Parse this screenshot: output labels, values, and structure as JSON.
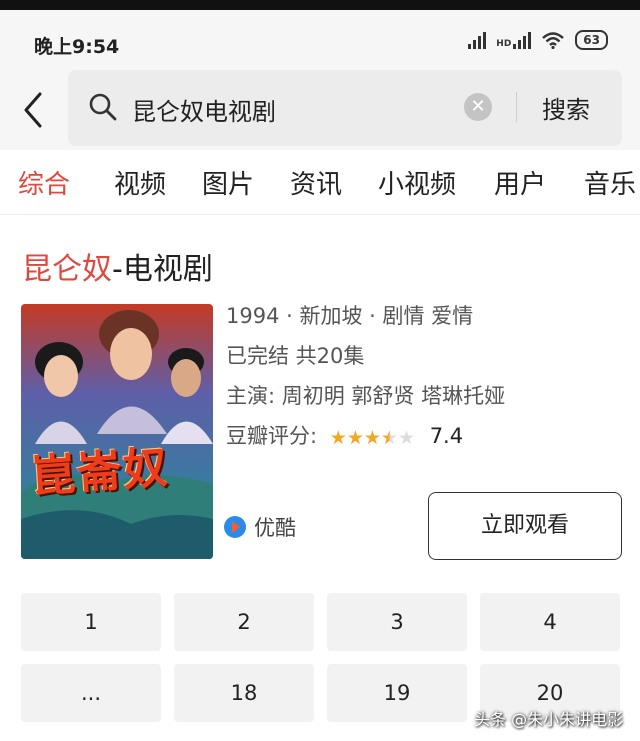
{
  "status_bar": {
    "time": "晚上9:54",
    "network": "HD",
    "battery": "63"
  },
  "search": {
    "query": "昆仑奴电视剧",
    "submit_label": "搜索"
  },
  "tabs": [
    "综合",
    "视频",
    "图片",
    "资讯",
    "小视频",
    "用户",
    "音乐"
  ],
  "active_tab": "综合",
  "result": {
    "title_highlight": "昆仑奴",
    "title_suffix": "-电视剧",
    "poster_text": "崑崙奴",
    "meta_line1": "1994 · 新加坡 · 剧情 爱情",
    "meta_line2": "已完结 共20集",
    "meta_line3": "主演: 周初明 郭舒贤 塔琳托娅",
    "rating_label": "豆瓣评分:",
    "rating_stars": 3.5,
    "rating_score": "7.4",
    "source": "优酷",
    "watch_button": "立即观看"
  },
  "episodes": [
    "1",
    "2",
    "3",
    "4",
    "...",
    "18",
    "19",
    "20"
  ],
  "watermark": "头条 @朱小朱讲电影",
  "colors": {
    "accent": "#e0473d",
    "star": "#f5a623",
    "star_empty": "#dddddd"
  }
}
